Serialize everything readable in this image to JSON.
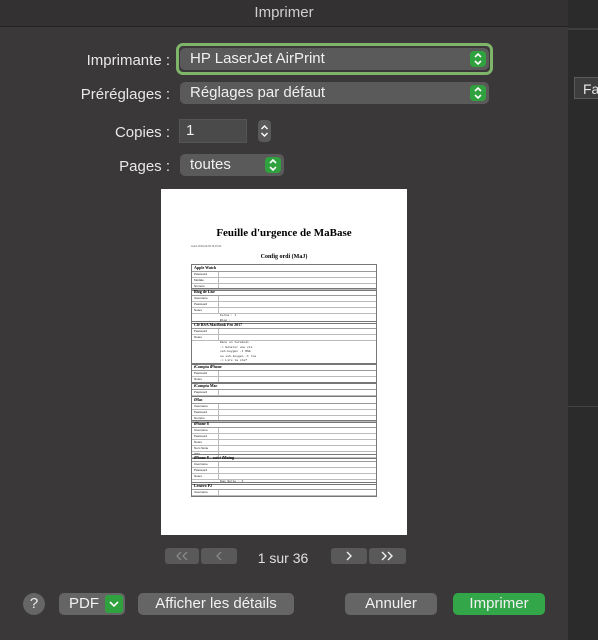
{
  "window": {
    "title": "Imprimer"
  },
  "printer": {
    "label": "Imprimante :",
    "value": "HP LaserJet AirPrint"
  },
  "presets": {
    "label": "Préréglages :",
    "value": "Réglages par défaut"
  },
  "copies": {
    "label": "Copies :",
    "value": "1"
  },
  "pages": {
    "label": "Pages :",
    "value": "toutes"
  },
  "preview": {
    "doc_title": "Feuille d'urgence de MaBase",
    "doc_meta": "Avant 2019-09-09 16:16:03",
    "section_title": "Config ordi (MaJ)",
    "blocks": [
      {
        "title": "Apple Watch",
        "rows": [
          "Password",
          "Modèle",
          "Numéro"
        ]
      },
      {
        "title": "Blog de Lise",
        "rows": [
          "Username",
          "Password",
          "Notes"
        ],
        "notes": "Forum : l\nBlog :"
      },
      {
        "title": "Clé RSA MacBook Pro 2017",
        "rows": [
          "Password",
          "Notes"
        ],
        "notes": "Dans un terminal\n-> Générer une clé\nssh-keygen -t RSA\nou ssh-keygen -t rsa\n-> Lire la clef"
      },
      {
        "title": "iCompta iPhone",
        "rows": [
          "Password",
          "Notes"
        ]
      },
      {
        "title": "iCompta Mac",
        "rows": [
          "Password"
        ]
      },
      {
        "title": "iMac",
        "rows": [
          "Username",
          "Password",
          "Numéro"
        ]
      },
      {
        "title": "iPhone 8",
        "rows": [
          "Username",
          "Password",
          "Notes",
          "Num Série",
          "IMEI"
        ]
      },
      {
        "title": "iPhone 8 – suivi iMaing",
        "rows": [
          "Username",
          "Password",
          "Notes"
        ],
        "notes": "Num Série : F"
      },
      {
        "title": "Lenovo P2",
        "rows": [
          "Username"
        ]
      }
    ]
  },
  "navigation": {
    "page_count": "1 sur 36"
  },
  "buttons": {
    "help": "?",
    "pdf": "PDF",
    "details": "Afficher les détails",
    "cancel": "Annuler",
    "print": "Imprimer"
  },
  "background_window": {
    "partial_label": "Fa"
  },
  "colors": {
    "accent": "#33a64a",
    "focus": "#7fb56b",
    "sheet": "#3a3839"
  }
}
